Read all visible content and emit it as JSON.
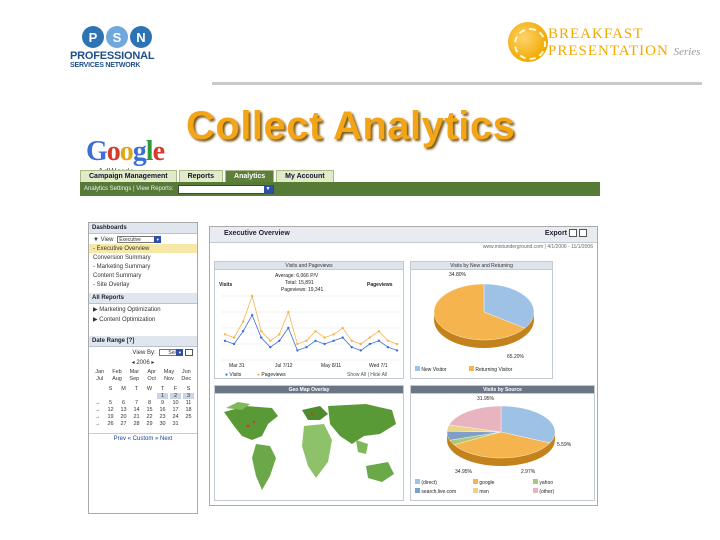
{
  "slide": {
    "title": "Collect Analytics",
    "psn": {
      "letters": [
        "P",
        "S",
        "N"
      ],
      "line1": "PROFESSIONAL",
      "line2": "SERVICES NETWORK"
    },
    "breakfast": {
      "line1": "BREAKFAST",
      "line2": "PRESENTATION",
      "series": "Series"
    },
    "google": {
      "letters": [
        "G",
        "o",
        "o",
        "g",
        "l",
        "e"
      ],
      "sub": "AdWords"
    }
  },
  "nav": {
    "tabs": [
      "Campaign Management",
      "Reports",
      "Analytics",
      "My Account"
    ],
    "active_tab": "Analytics",
    "subnav": "Analytics Settings | View Reports:"
  },
  "left": {
    "dashboards": "Dashboards",
    "view_label": "View",
    "view_value": "Executive",
    "items": [
      "- Executive Overview",
      "Conversion Summary",
      "- Marketing Summary",
      "Content Summary",
      "- Site Overlay"
    ],
    "all_reports": "All Reports",
    "reports": [
      "Marketing Optimization",
      "Content Optimization"
    ],
    "date_range": "Date Range [?]",
    "view_by_label": "View By:",
    "view_by_value": "Select",
    "year": "2006",
    "months": [
      [
        "Jan",
        "Feb",
        "Mar",
        "Apr",
        "May",
        "Jun"
      ],
      [
        "Jul",
        "Aug",
        "Sep",
        "Oct",
        "Nov",
        "Dec"
      ]
    ],
    "weekdays": [
      "",
      "S",
      "M",
      "T",
      "W",
      "T",
      "F",
      "S"
    ],
    "weeks": [
      [
        "",
        "",
        "",
        "",
        "",
        "1",
        "2",
        "3"
      ],
      [
        "→",
        "5",
        "6",
        "7",
        "8",
        "9",
        "10",
        "11"
      ],
      [
        "→",
        "12",
        "13",
        "14",
        "15",
        "16",
        "17",
        "18"
      ],
      [
        "→",
        "19",
        "20",
        "21",
        "22",
        "23",
        "24",
        "25"
      ],
      [
        "→",
        "26",
        "27",
        "28",
        "29",
        "30",
        "31",
        ""
      ]
    ],
    "nav_text": "Prev « Custom » Next"
  },
  "main": {
    "title": "Executive Overview",
    "export": "Export",
    "dates": "www.mistunderground.com | 4/1/2006 - 11/1/2006",
    "visits_panel": {
      "header": "Visits and Pageviews",
      "avg": "Average: 6,066 P/V",
      "visits_label": "Visits",
      "visits_total": "Total: 15,891",
      "pageviews_total": "Pageviews: 19,341",
      "pageviews_label": "Pageviews",
      "x_labels": [
        "Mar 31",
        "Jul 7/12",
        "May 8/11",
        "Wed 7/1"
      ],
      "legend": [
        "Visits",
        "Pageviews"
      ],
      "footer": "Show All | Hide All"
    },
    "new_return_panel": {
      "header": "Visits by New and Returning",
      "pct_top": "34.80%",
      "pct_bottom": "65.20%",
      "legend": [
        "New Visitor",
        "Returning Visitor"
      ]
    },
    "geo_panel": {
      "header": "Geo Map Overlay"
    },
    "source_panel": {
      "header": "Visits by Source",
      "pct_top": "31.95%",
      "pct_left": "34.95%",
      "pct_bottom": "2.97%",
      "pct_right": "5.59%",
      "legend": [
        "(direct)",
        "google",
        "yahoo",
        "search.live.com",
        "msn",
        "(other)"
      ]
    }
  },
  "colors": {
    "title": "#f4a417",
    "tab_active": "#5d7f3a",
    "green_bar": "#567b36",
    "pie_blue": "#9ec1e6",
    "pie_orange": "#f6b44e",
    "pie_green": "#a8c87a",
    "pie_pink": "#e8b4c0",
    "pie_grey": "#c8c8c8",
    "map_green": "#5a9a36"
  },
  "chart_data": [
    {
      "type": "line",
      "title": "Visits and Pageviews",
      "x": [
        "Mar 31",
        "Jul 7/12",
        "May 8/11",
        "Wed 7/1"
      ],
      "series": [
        {
          "name": "Visits",
          "values": [
            60,
            50,
            90,
            140,
            70,
            40,
            60,
            100,
            30,
            40,
            60,
            50,
            60,
            70,
            40,
            30,
            50,
            60,
            40,
            30
          ]
        },
        {
          "name": "Pageviews",
          "values": [
            80,
            70,
            120,
            200,
            90,
            60,
            80,
            150,
            50,
            60,
            90,
            70,
            80,
            100,
            60,
            50,
            70,
            90,
            60,
            50
          ]
        }
      ]
    },
    {
      "type": "pie",
      "title": "Visits by New and Returning",
      "categories": [
        "New Visitor",
        "Returning Visitor"
      ],
      "values": [
        34.8,
        65.2
      ]
    },
    {
      "type": "pie",
      "title": "Visits by Source",
      "categories": [
        "(direct)",
        "google",
        "yahoo",
        "search.live.com",
        "msn",
        "(other)"
      ],
      "values": [
        31.95,
        34.95,
        2.97,
        5.59,
        4.0,
        20.54
      ]
    }
  ]
}
